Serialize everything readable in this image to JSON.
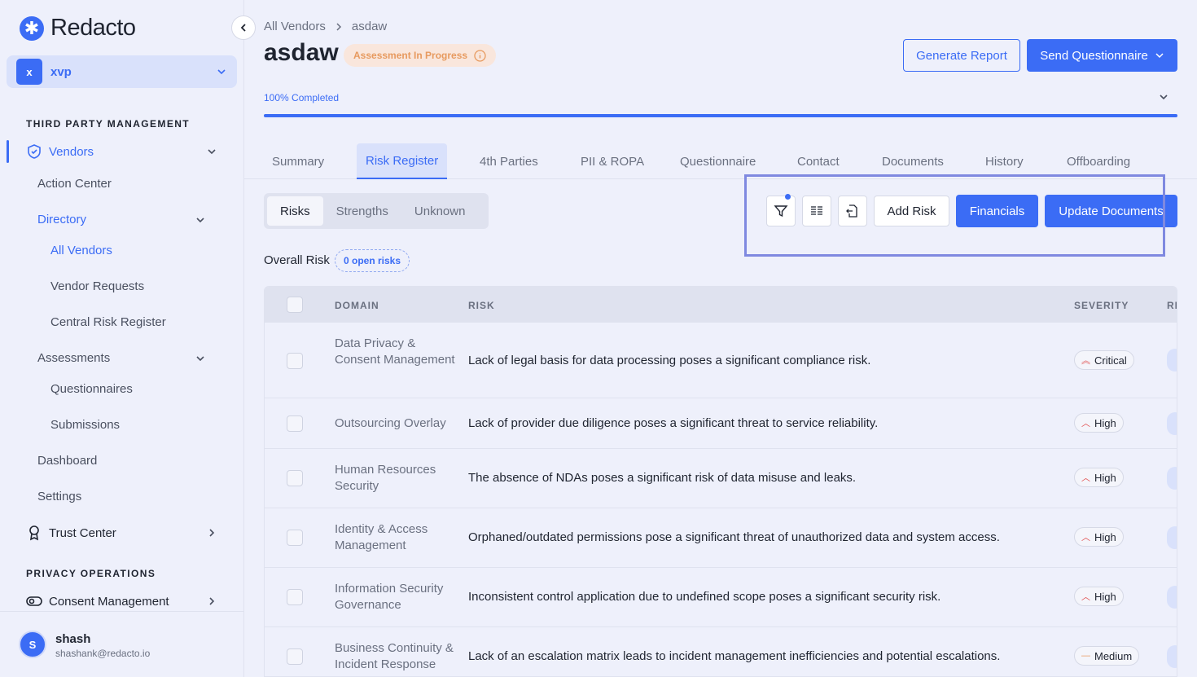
{
  "app": {
    "name": "Redacto",
    "workspace": {
      "initial": "x",
      "name": "xvp"
    }
  },
  "sidebar": {
    "section_tpm": "THIRD PARTY MANAGEMENT",
    "vendors": "Vendors",
    "action_center": "Action Center",
    "directory": "Directory",
    "all_vendors": "All Vendors",
    "vendor_requests": "Vendor Requests",
    "central_risk_register": "Central Risk Register",
    "assessments": "Assessments",
    "questionnaires": "Questionnaires",
    "submissions": "Submissions",
    "dashboard": "Dashboard",
    "settings": "Settings",
    "trust_center": "Trust Center",
    "section_privacy": "PRIVACY OPERATIONS",
    "consent_management": "Consent Management"
  },
  "user": {
    "initial": "S",
    "name": "shash",
    "email": "shashank@redacto.io"
  },
  "breadcrumb": {
    "root": "All Vendors",
    "current": "asdaw"
  },
  "vendor": {
    "title": "asdaw",
    "status": "Assessment In Progress",
    "progress_label": "100% Completed",
    "progress": 1.0
  },
  "actions": {
    "generate_report": "Generate Report",
    "send_questionnaire": "Send Questionnaire"
  },
  "tabs": [
    "Summary",
    "Risk Register",
    "4th Parties",
    "PII & ROPA",
    "Questionnaire",
    "Contact",
    "Documents",
    "History",
    "Offboarding"
  ],
  "segments": [
    "Risks",
    "Strengths",
    "Unknown"
  ],
  "toolbar": {
    "add_risk": "Add Risk",
    "financials": "Financials",
    "update_documents": "Update Documents"
  },
  "overall": {
    "label": "Overall Risk",
    "open_risks": "0 open risks"
  },
  "table": {
    "headers": {
      "domain": "DOMAIN",
      "risk": "RISK",
      "severity": "SEVERITY",
      "cut": "RI"
    },
    "rows": [
      {
        "domain": "Data Privacy & Consent Management",
        "risk": "Lack of legal basis for data processing poses a significant compliance risk.",
        "severity": "Critical"
      },
      {
        "domain": "Outsourcing Overlay",
        "risk": "Lack of provider due diligence poses a significant threat to service reliability.",
        "severity": "High"
      },
      {
        "domain": "Human Resources Security",
        "risk": "The absence of NDAs poses a significant risk of data misuse and leaks.",
        "severity": "High"
      },
      {
        "domain": "Identity & Access Management",
        "risk": "Orphaned/outdated permissions pose a significant threat of unauthorized data and system access.",
        "severity": "High"
      },
      {
        "domain": "Information Security Governance",
        "risk": "Inconsistent control application due to undefined scope poses a significant security risk.",
        "severity": "High"
      },
      {
        "domain": "Business Continuity & Incident Response",
        "risk": "Lack of an escalation matrix leads to incident management inefficiencies and potential escalations.",
        "severity": "Medium"
      }
    ]
  },
  "colors": {
    "accent": "#3b6cf5",
    "warning": "#e79a5f",
    "critical": "#e14d4d"
  }
}
